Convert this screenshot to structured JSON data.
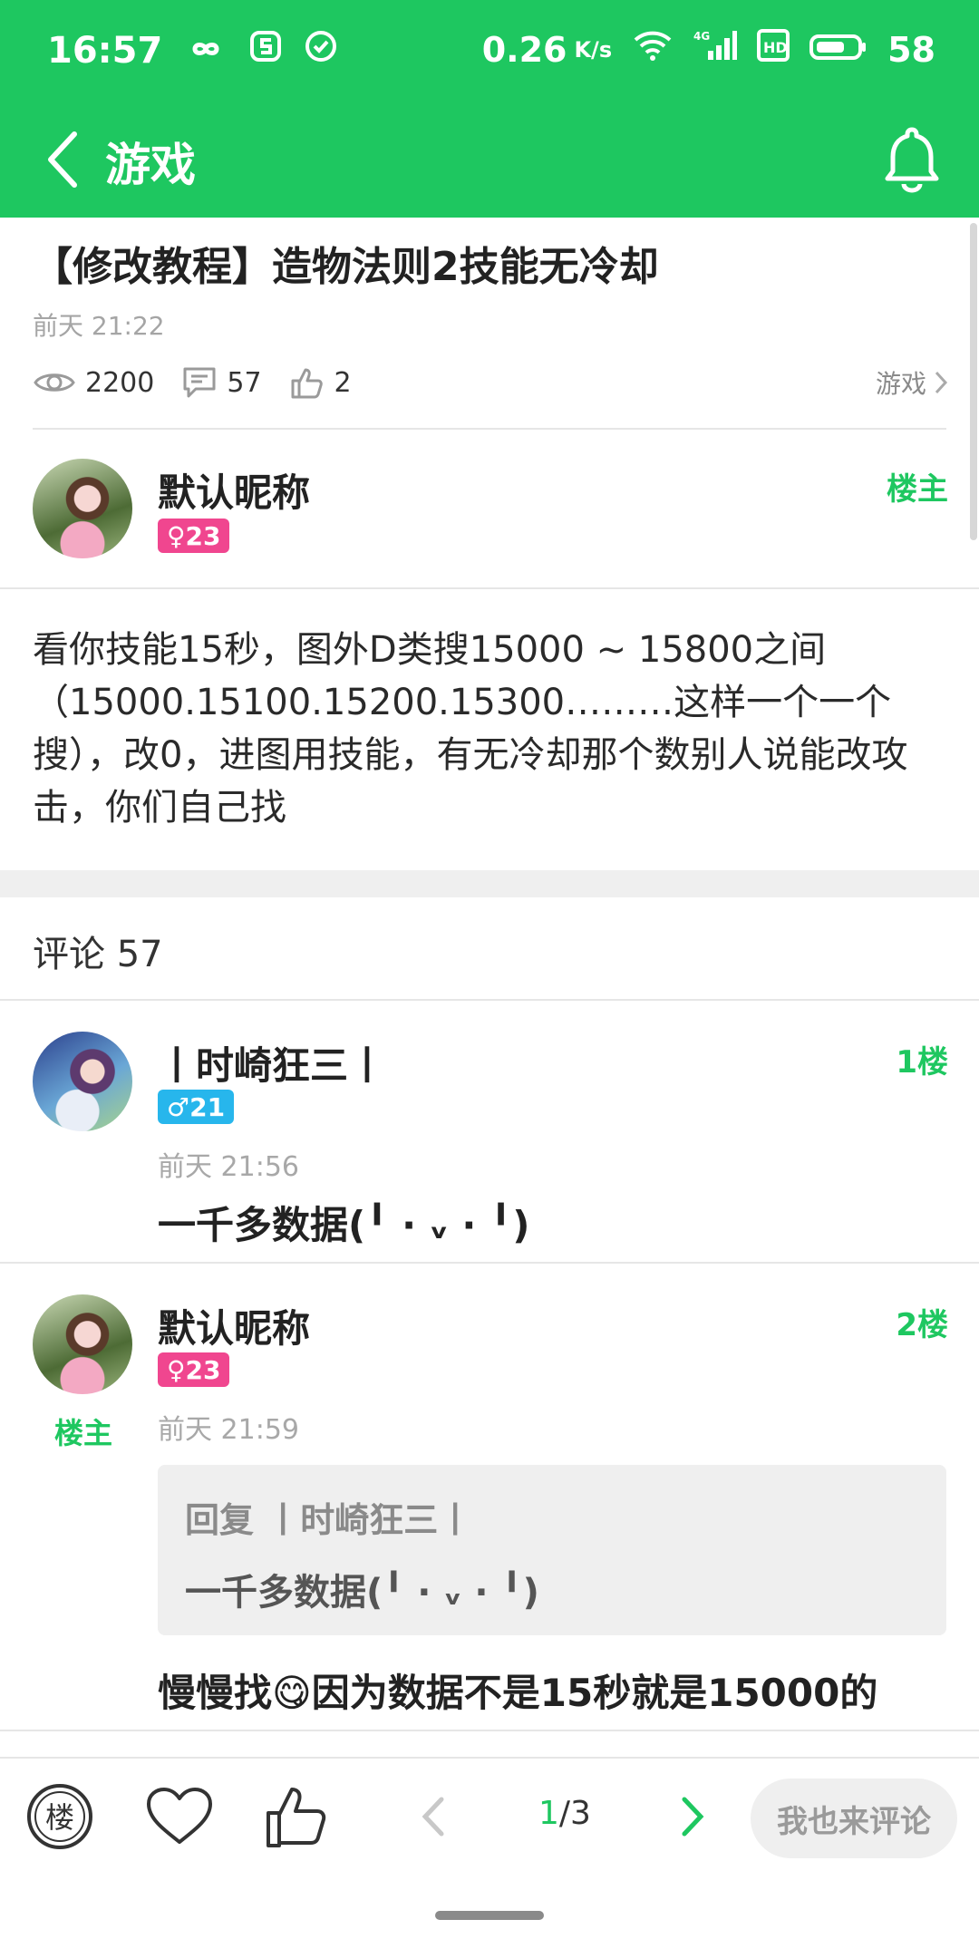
{
  "status_bar": {
    "time": "16:57",
    "left_icons": [
      "infinity-icon",
      "s-icon",
      "check-circle-icon"
    ],
    "speed": "0.26",
    "speed_unit": "K/s",
    "network": "4G",
    "battery": "58"
  },
  "toolbar": {
    "title": "游戏"
  },
  "post": {
    "title": "【修改教程】造物法则2技能无冷却",
    "time": "前天 21:22",
    "views": "2200",
    "comments": "57",
    "likes": "2",
    "category": "游戏",
    "author": {
      "name": "默认昵称",
      "gender_age": "♀23",
      "floor": "楼主"
    },
    "body": "看你技能15秒，图外D类搜15000 ~ 15800之间（15000.15100.15200.15300………这样一个一个搜），改0，进图用技能，有无冷却那个数别人说能改攻击，你们自己找"
  },
  "comments_section": {
    "header": "评论 57",
    "items": [
      {
        "name": "丨时崎狂三丨",
        "gender_age": "♂21",
        "floor": "1楼",
        "time": "前天 21:56",
        "text": "一千多数据(╹ · ᵥ · ╹)"
      },
      {
        "name": "默认昵称",
        "gender_age": "♀23",
        "floor": "2楼",
        "op_label": "楼主",
        "time": "前天 21:59",
        "quote_prefix": "回复 丨时崎狂三丨",
        "quote_text": "一千多数据(╹ · ᵥ · ╹)",
        "text": "慢慢找😋因为数据不是15秒就是15000的"
      }
    ]
  },
  "bottom_bar": {
    "floor_icon_label": "楼",
    "page_current": "1",
    "page_total": "/3",
    "comment_button": "我也来评论"
  },
  "colors": {
    "accent": "#1ec760",
    "female_badge": "#f0468f",
    "male_badge": "#27b6ec"
  }
}
